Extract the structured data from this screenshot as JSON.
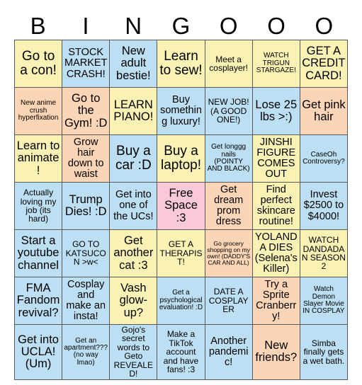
{
  "card": {
    "title": "BINGO card",
    "headers": [
      "B",
      "I",
      "N",
      "G",
      "O",
      "O",
      "O"
    ],
    "free_space_color": "#f9c9da",
    "colors": {
      "yellow": "#faf2b4",
      "blue": "#bddff3",
      "orange": "#fbd5b5",
      "pink": "#f9c9da"
    },
    "rows": [
      [
        {
          "text": "Go to a con!",
          "color": "yellow",
          "size": "fs-xl"
        },
        {
          "text": "STOCK MARKET CRASH!",
          "color": "blue",
          "size": "fs-md"
        },
        {
          "text": "New adult bestie!",
          "color": "blue",
          "size": "fs-lg"
        },
        {
          "text": "Learn to sew!",
          "color": "yellow",
          "size": "fs-xl"
        },
        {
          "text": "Meet a cosplayer!",
          "color": "yellow",
          "size": "fs-sm"
        },
        {
          "text": "WATCH TRIGUN STARGAZE!",
          "color": "yellow",
          "size": "fs-xs"
        },
        {
          "text": "GET A CREDIT CARD!",
          "color": "yellow",
          "size": "fs-lg"
        }
      ],
      [
        {
          "text": "New anime crush hyperfixation",
          "color": "orange",
          "size": "fs-xs"
        },
        {
          "text": "Go to the Gym! :D",
          "color": "orange",
          "size": "fs-lg"
        },
        {
          "text": "LEARN PIANO!",
          "color": "yellow",
          "size": "fs-lg"
        },
        {
          "text": "Buy something luxury!",
          "color": "blue",
          "size": "fs-md"
        },
        {
          "text": "NEW JOB! (A GOOD ONE!)",
          "color": "blue",
          "size": "fs-sm"
        },
        {
          "text": "Lose 25 lbs >:)",
          "color": "blue",
          "size": "fs-lg"
        },
        {
          "text": "Get pink hair",
          "color": "orange",
          "size": "fs-lg"
        }
      ],
      [
        {
          "text": "Learn to animate!",
          "color": "yellow",
          "size": "fs-lg"
        },
        {
          "text": "Grow hair down to waist",
          "color": "orange",
          "size": "fs-md"
        },
        {
          "text": "Buy a car :D",
          "color": "blue",
          "size": "fs-xl"
        },
        {
          "text": "Buy a laptop!",
          "color": "yellow",
          "size": "fs-xl"
        },
        {
          "text": "Get longgg nails (POINTY AND BLACK)",
          "color": "blue",
          "size": "fs-xs"
        },
        {
          "text": "JINSHI FIGURE COMES OUT",
          "color": "yellow",
          "size": "fs-md"
        },
        {
          "text": "CaseOh Controversy?",
          "color": "blue",
          "size": "fs-xs"
        }
      ],
      [
        {
          "text": "Actually loving my job (its hard)",
          "color": "blue",
          "size": "fs-sm"
        },
        {
          "text": "Trump Dies! :D",
          "color": "blue",
          "size": "fs-lg"
        },
        {
          "text": "Get into one of the UCs!",
          "color": "blue",
          "size": "fs-md"
        },
        {
          "text": "Free Space :3",
          "color": "pink",
          "size": "fs-lg"
        },
        {
          "text": "Get dream prom dress",
          "color": "orange",
          "size": "fs-md"
        },
        {
          "text": "Find perfect skincare routine!",
          "color": "yellow",
          "size": "fs-md"
        },
        {
          "text": "Invest $2500 to $4000!",
          "color": "blue",
          "size": "fs-md"
        }
      ],
      [
        {
          "text": "Start a youtube channel",
          "color": "blue",
          "size": "fs-lg"
        },
        {
          "text": "GO TO KATSUCON >w<",
          "color": "blue",
          "size": "fs-sm"
        },
        {
          "text": "Get another cat :3",
          "color": "yellow",
          "size": "fs-lg"
        },
        {
          "text": "GET A THERAPIST!",
          "color": "yellow",
          "size": "fs-sm"
        },
        {
          "text": "Go grocery shopping on my own! (DADDY'S CAR AND ALL)",
          "color": "orange",
          "size": "fs-xxs"
        },
        {
          "text": "YOLANDA DIES (Selena's Killer)",
          "color": "yellow",
          "size": "fs-md"
        },
        {
          "text": "WATCH DANDADAN SEASON 2",
          "color": "yellow",
          "size": "fs-sm"
        }
      ],
      [
        {
          "text": "FMA Fandom revival?",
          "color": "blue",
          "size": "fs-lg"
        },
        {
          "text": "Cosplay and make an insta!",
          "color": "blue",
          "size": "fs-md"
        },
        {
          "text": "Vash glow-up?",
          "color": "yellow",
          "size": "fs-lg"
        },
        {
          "text": "Get a psychological evaluation! :D",
          "color": "blue",
          "size": "fs-xs"
        },
        {
          "text": "DATE A COSPLAYER",
          "color": "blue",
          "size": "fs-sm"
        },
        {
          "text": "Try a Sprite Cranberry!",
          "color": "orange",
          "size": "fs-md"
        },
        {
          "text": "Watch Demon Slayer Movie IN COSPLAY",
          "color": "blue",
          "size": "fs-xs"
        }
      ],
      [
        {
          "text": "Get into UCLA! (Um)",
          "color": "blue",
          "size": "fs-lg"
        },
        {
          "text": "Get an apartment??? (no way lmao)",
          "color": "blue",
          "size": "fs-xs"
        },
        {
          "text": "Gojo's secret words to Geto REVEALED!",
          "color": "blue",
          "size": "fs-sm"
        },
        {
          "text": "Make a TikTok account and have fans! :3",
          "color": "blue",
          "size": "fs-sm"
        },
        {
          "text": "Another pandemic!",
          "color": "blue",
          "size": "fs-md"
        },
        {
          "text": "New friends?",
          "color": "orange",
          "size": "fs-lg"
        },
        {
          "text": "Simba finally gets a wet bath.",
          "color": "blue",
          "size": "fs-sm"
        }
      ]
    ]
  }
}
